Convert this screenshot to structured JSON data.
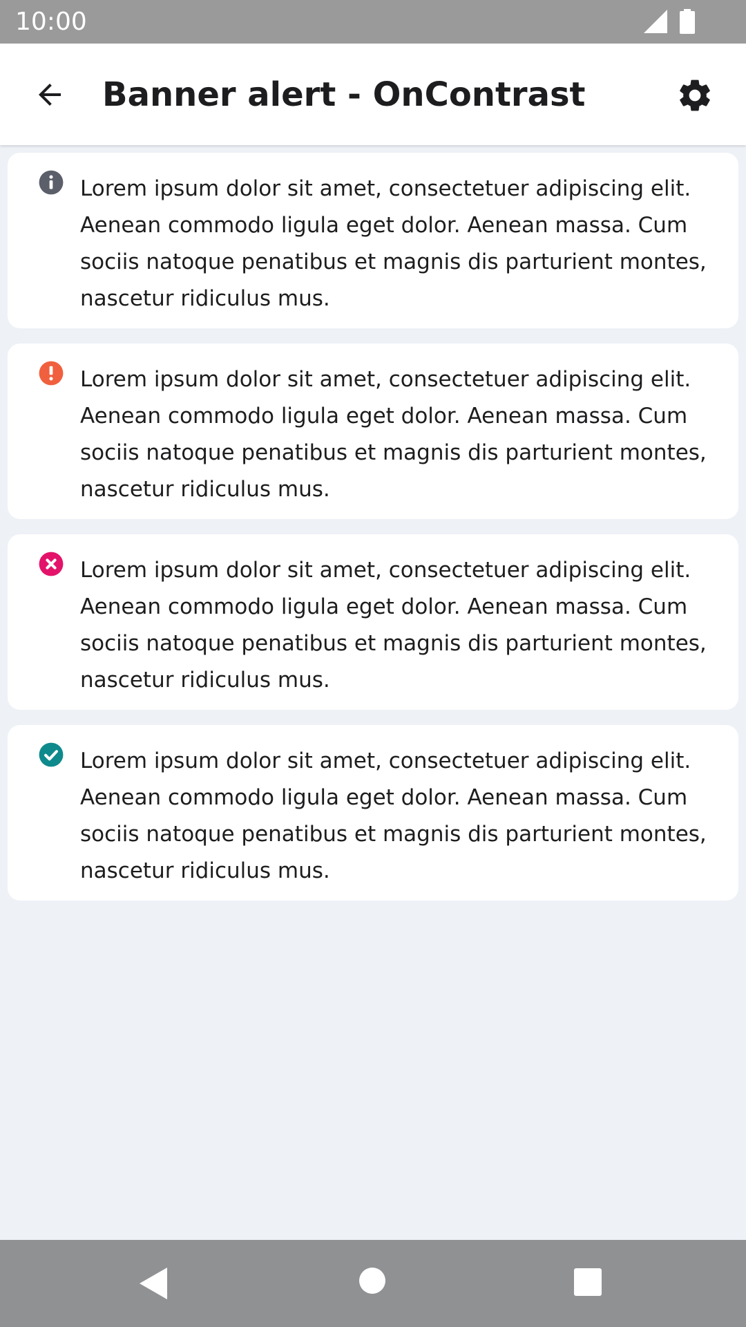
{
  "status_bar": {
    "time": "10:00",
    "icons": [
      "signal-icon",
      "battery-icon"
    ]
  },
  "app_bar": {
    "title": "Banner alert - OnContrast",
    "back_icon": "arrow-left-icon",
    "settings_icon": "gear-icon"
  },
  "banners": [
    {
      "variant": "info",
      "icon": "info-icon",
      "color": "#5b5f6a",
      "text": "Lorem ipsum dolor sit amet, consectetuer adipiscing elit. Aenean commodo ligula eget dolor. Aenean massa. Cum sociis natoque penatibus et magnis dis parturient montes, nascetur ridiculus mus."
    },
    {
      "variant": "warning",
      "icon": "warning-icon",
      "color": "#f0603e",
      "text": "Lorem ipsum dolor sit amet, consectetuer adipiscing elit. Aenean commodo ligula eget dolor. Aenean massa. Cum sociis natoque penatibus et magnis dis parturient montes, nascetur ridiculus mus."
    },
    {
      "variant": "error",
      "icon": "error-icon",
      "color": "#e4136a",
      "text": "Lorem ipsum dolor sit amet, consectetuer adipiscing elit. Aenean commodo ligula eget dolor. Aenean massa. Cum sociis natoque penatibus et magnis dis parturient montes, nascetur ridiculus mus."
    },
    {
      "variant": "success",
      "icon": "check-circle-icon",
      "color": "#0f8a8c",
      "text": "Lorem ipsum dolor sit amet, consectetuer adipiscing elit. Aenean commodo ligula eget dolor. Aenean massa. Cum sociis natoque penatibus et magnis dis parturient montes, nascetur ridiculus mus."
    }
  ],
  "nav_bar": {
    "icons": [
      "nav-back-icon",
      "nav-home-icon",
      "nav-recents-icon"
    ]
  }
}
